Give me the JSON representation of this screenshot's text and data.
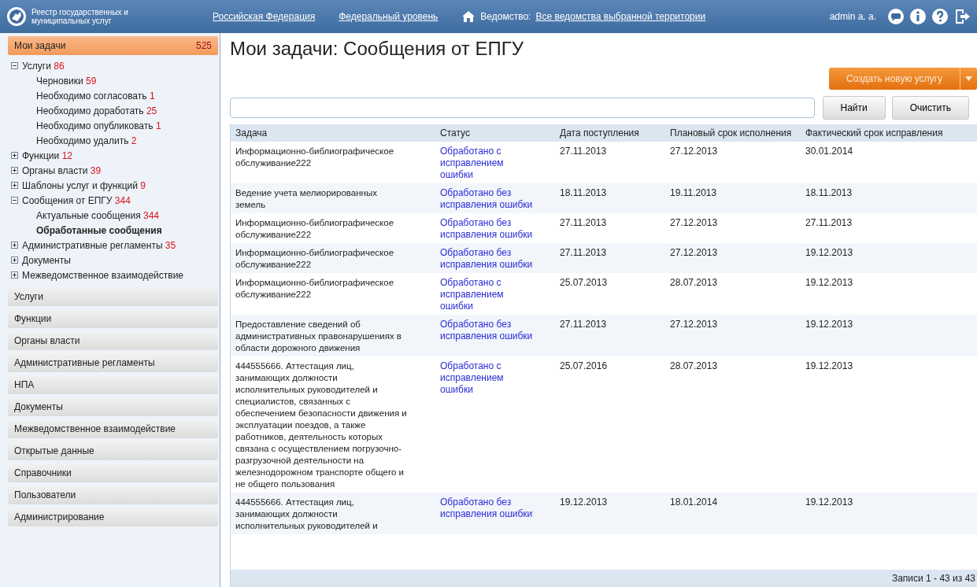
{
  "header": {
    "app_name": "Реестр государственных и муниципальных услуг",
    "links": [
      "Российская Федерация",
      "Федеральный уровень"
    ],
    "agency_label": "Ведомство:",
    "agency_value": "Все ведомства выбранной территории",
    "user": "admin a. a."
  },
  "sidebar": {
    "sections": [
      {
        "label": "Мои задачи",
        "count": "525",
        "selected": true,
        "tree": [
          {
            "label": "Услуги",
            "count": "86",
            "expanded": true,
            "children": [
              {
                "label": "Черновики",
                "count": "59",
                "selected": false
              },
              {
                "label": "Необходимо согласовать",
                "count": "1",
                "selected": false
              },
              {
                "label": "Необходимо доработать",
                "count": "25",
                "selected": false
              },
              {
                "label": "Необходимо опубликовать",
                "count": "1",
                "selected": false
              },
              {
                "label": "Необходимо удалить",
                "count": "2",
                "selected": false
              }
            ]
          },
          {
            "label": "Функции",
            "count": "12",
            "expanded": false
          },
          {
            "label": "Органы власти",
            "count": "39",
            "expanded": false
          },
          {
            "label": "Шаблоны услуг и функций",
            "count": "9",
            "expanded": false
          },
          {
            "label": "Сообщения от ЕПГУ",
            "count": "344",
            "expanded": true,
            "children": [
              {
                "label": "Актуальные сообщения",
                "count": "344",
                "selected": false
              },
              {
                "label": "Обработанные сообщения",
                "selected": true
              }
            ]
          },
          {
            "label": "Административные регламенты",
            "count": "35",
            "expanded": false
          },
          {
            "label": "Документы",
            "expanded": false
          },
          {
            "label": "Межведомственное взаимодействие",
            "expanded": false
          }
        ]
      },
      {
        "label": "Услуги",
        "selected": false
      },
      {
        "label": "Функции",
        "selected": false
      },
      {
        "label": "Органы власти",
        "selected": false
      },
      {
        "label": "Административные регламенты",
        "selected": false
      },
      {
        "label": "НПА",
        "selected": false
      },
      {
        "label": "Документы",
        "selected": false
      },
      {
        "label": "Межведомственное взаимодействие",
        "selected": false
      },
      {
        "label": "Открытые данные",
        "selected": false
      },
      {
        "label": "Справочники",
        "selected": false
      },
      {
        "label": "Пользователи",
        "selected": false
      },
      {
        "label": "Администрирование",
        "selected": false
      }
    ]
  },
  "main": {
    "title": "Мои задачи: Сообщения от ЕПГУ",
    "create_button": "Создать новую услугу",
    "find_button": "Найти",
    "clear_button": "Очистить",
    "table": {
      "columns": [
        "Задача",
        "Статус",
        "Дата поступления",
        "Плановый срок исполнения",
        "Фактический срок исправления"
      ],
      "rows": [
        [
          "Информационно-библиографическое обслуживание222",
          "Обработано с исправлением ошибки",
          "27.11.2013",
          "27.12.2013",
          "30.01.2014"
        ],
        [
          "Ведение учета мелиорированных земель",
          "Обработано без исправления ошибки",
          "18.11.2013",
          "19.11.2013",
          "18.11.2013"
        ],
        [
          "Информационно-библиографическое обслуживание222",
          "Обработано без исправления ошибки",
          "27.11.2013",
          "27.12.2013",
          "27.11.2013"
        ],
        [
          "Информационно-библиографическое обслуживание222",
          "Обработано без исправления ошибки",
          "27.11.2013",
          "27.12.2013",
          "19.12.2013"
        ],
        [
          "Информационно-библиографическое обслуживание222",
          "Обработано с исправлением ошибки",
          "25.07.2013",
          "28.07.2013",
          "19.12.2013"
        ],
        [
          "Предоставление сведений об административных правонарушениях в области дорожного движения",
          "Обработано без исправления ошибки",
          "27.11.2013",
          "27.12.2013",
          "19.12.2013"
        ],
        [
          "444555666. Аттестация лиц, занимающих должности исполнительных руководителей и специалистов, связанных с обеспечением безопасности движения и эксплуатации поездов, а также работников, деятельность которых связана с осуществлением погрузочно-разгрузочной деятельности на железнодорожном транспорте общего и не общего пользования",
          "Обработано с исправлением ошибки",
          "25.07.2016",
          "28.07.2013",
          "19.12.2013"
        ],
        [
          "444555666. Аттестация лиц, занимающих должности исполнительных руководителей и",
          "Обработано без исправления ошибки",
          "19.12.2013",
          "18.01.2014",
          "19.12.2013"
        ]
      ]
    },
    "footer": "Записи 1 - 43 из 43"
  }
}
